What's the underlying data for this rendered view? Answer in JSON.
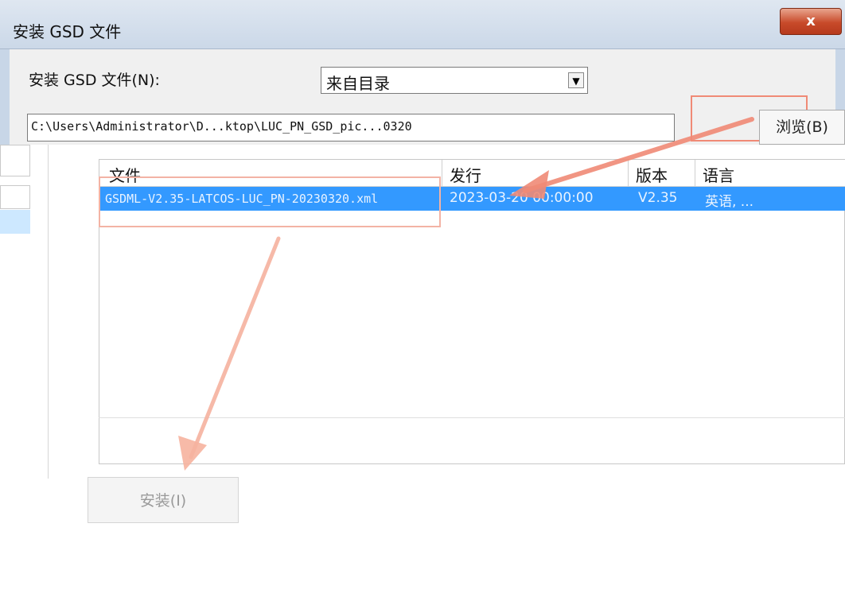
{
  "window": {
    "title": "安装 GSD 文件",
    "close_label": "x"
  },
  "source": {
    "label": "安装 GSD 文件(N):",
    "selected": "来自目录",
    "arrow_icon": "▼"
  },
  "path": {
    "value": "C:\\Users\\Administrator\\D...ktop\\LUC_PN_GSD_pic...0320"
  },
  "browse": {
    "label": "浏览(B)"
  },
  "list": {
    "columns": [
      "文件",
      "发行",
      "版本",
      "语言"
    ],
    "rows": [
      {
        "file": "GSDML-V2.35-LATCOS-LUC_PN-20230320.xml",
        "release": "2023-03-20 00:00:00",
        "version": "V2.35",
        "language": "英语, ..."
      }
    ]
  },
  "install": {
    "label": "安装(I)"
  },
  "colors": {
    "selection": "#3399ff",
    "annotation": "#f08a76"
  }
}
